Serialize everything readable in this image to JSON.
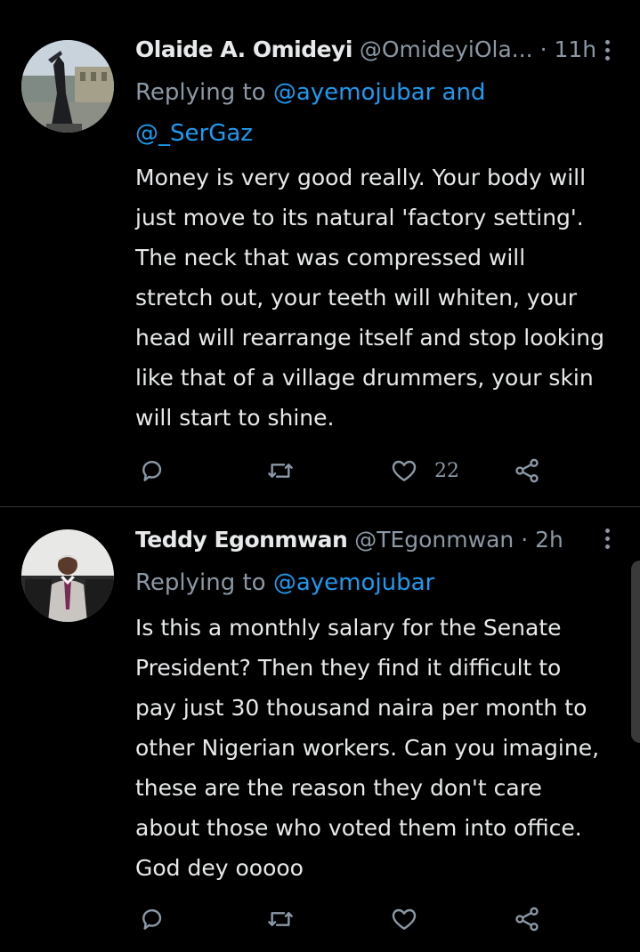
{
  "tweets": [
    {
      "name": "Olaide A. Omideyi",
      "handle": "@OmideyiOla...",
      "dot": " · ",
      "time": "11h",
      "replying_prefix": "Replying to ",
      "mention_1": "@ayemojubar",
      "replying_and": " and",
      "mention_2": "@_SerGaz",
      "text": "Money is very good really. Your body will\njust move to its natural 'factory setting'.\nThe neck that was compressed will\nstretch out, your teeth will whiten, your\nhead will rearrange itself and stop looking\nlike that of a village drummers, your skin\nwill start to shine.",
      "like_count": "22",
      "avatar_icon": "statue-photo"
    },
    {
      "name": "Teddy Egonmwan",
      "handle": "@TEgonmwan",
      "dot": " · ",
      "time": "2h",
      "replying_prefix": "Replying to ",
      "mention_1": "@ayemojubar",
      "text": "Is this a monthly salary for the Senate\nPresident? Then they find it difficult to\npay just 30 thousand naira per month to\nother Nigerian workers.  Can you imagine,\nthese are the reason they don't care\nabout those who voted them into office.\nGod dey ooooo",
      "like_count": "",
      "avatar_icon": "man-in-suit-photo"
    }
  ],
  "icons": {
    "reply": "reply-icon",
    "retweet": "retweet-icon",
    "like": "heart-icon",
    "share": "share-icon",
    "more": "more-vertical-icon"
  },
  "colors": {
    "background": "#000000",
    "text": "#e7e9ea",
    "secondary": "#8b98a5",
    "accent": "#1d9bf0",
    "divider": "#2f3336"
  }
}
